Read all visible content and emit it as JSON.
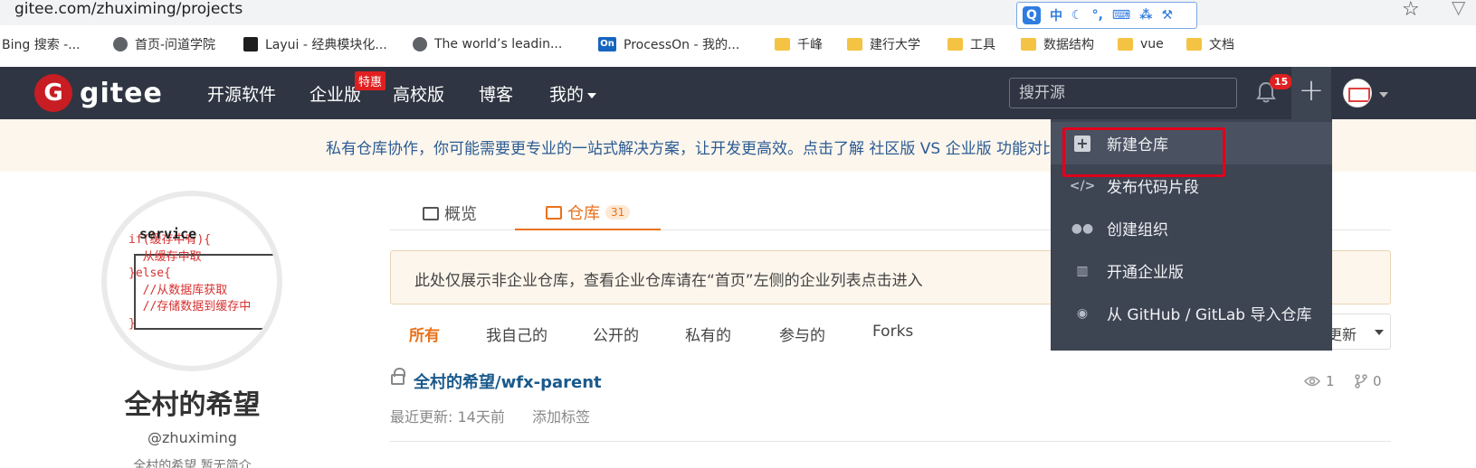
{
  "browser": {
    "url": "gitee.com/zhuximing/projects",
    "ime": {
      "logo": "Q",
      "mode": "中"
    },
    "bookmarks": [
      {
        "label": "Bing 搜索 -...",
        "icon": "none"
      },
      {
        "label": "首页-问道学院",
        "icon": "globe-icon"
      },
      {
        "label": "Layui - 经典模块化...",
        "icon": "layui-icon"
      },
      {
        "label": "The world’s leadin...",
        "icon": "globe-icon"
      },
      {
        "label": "ProcessOn - 我的...",
        "icon": "processon-icon",
        "icon_text": "On"
      },
      {
        "label": "千峰",
        "icon": "folder-icon"
      },
      {
        "label": "建行大学",
        "icon": "folder-icon"
      },
      {
        "label": "工具",
        "icon": "folder-icon"
      },
      {
        "label": "数据结构",
        "icon": "folder-icon"
      },
      {
        "label": "vue",
        "icon": "folder-icon"
      },
      {
        "label": "文档",
        "icon": "folder-icon"
      }
    ]
  },
  "nav": {
    "logo_letter": "G",
    "logo_text": "gitee",
    "links": [
      "开源软件",
      "企业版",
      "高校版",
      "博客",
      "我的"
    ],
    "enterprise_badge": "特惠",
    "search_placeholder": "搜开源",
    "notification_count": "15",
    "plus": "+"
  },
  "banner": {
    "text": "私有仓库协作，你可能需要更专业的一站式解决方案，让开发更高效。点击了解 社区版 VS 企业版 功能对比"
  },
  "profile": {
    "code_lines": "if(缓存中有){\n  从缓存中取\n}else{\n  //从数据库获取\n  //存储数据到缓存中\n}",
    "code_overlay": "service",
    "name": "全村的希望",
    "handle": "@zhuximing",
    "bio": "全村的希望 暂无简介"
  },
  "tabs": [
    {
      "label": "概览",
      "count": ""
    },
    {
      "label": "仓库",
      "count": "31"
    }
  ],
  "notice": "此处仅展示非企业仓库，查看企业仓库请在“首页”左侧的企业列表点击进入",
  "filters": [
    "所有",
    "我自己的",
    "公开的",
    "私有的",
    "参与的",
    "Forks"
  ],
  "sort_label": "更新",
  "repo": {
    "title": "全村的希望/wfx-parent",
    "updated": "最近更新: 14天前",
    "tag_action": "添加标签",
    "watch_count": "1",
    "fork_count": "0"
  },
  "dropdown": [
    {
      "label": "新建仓库",
      "icon": "plus-square-icon"
    },
    {
      "label": "发布代码片段",
      "icon": "code-icon"
    },
    {
      "label": "创建组织",
      "icon": "group-icon"
    },
    {
      "label": "开通企业版",
      "icon": "building-icon"
    },
    {
      "label": "从 GitHub / GitLab 导入仓库",
      "icon": "github-icon"
    }
  ],
  "colors": {
    "nav_bg": "#2f3542",
    "brand_red": "#c71d23",
    "accent_orange": "#e8711a",
    "link_blue": "#1a5a8c",
    "dropdown_bg": "#3d4452",
    "highlight_rect": "#e0001b"
  }
}
